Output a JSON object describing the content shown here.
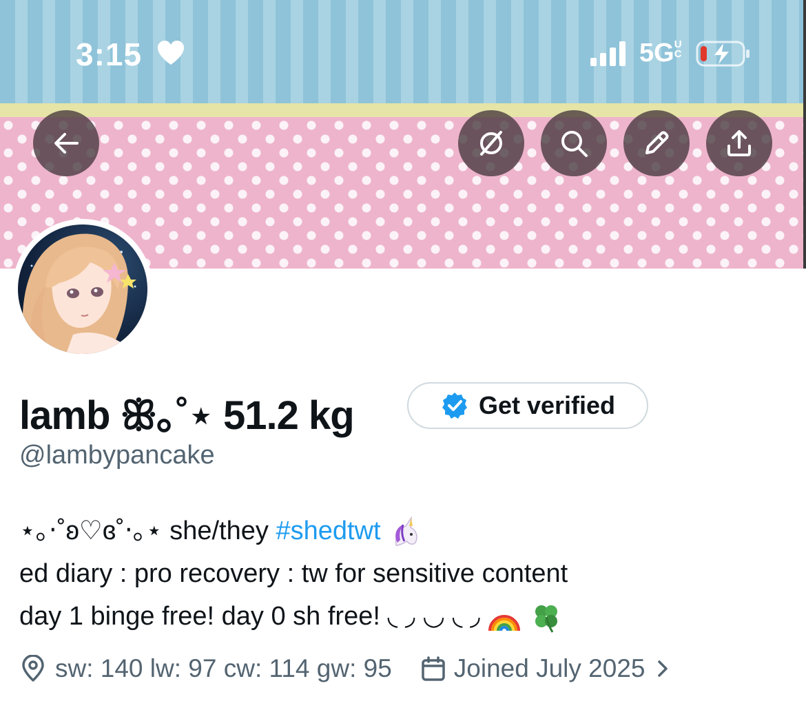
{
  "status_bar": {
    "time": "3:15",
    "network": "5G",
    "network_suffix": "UC"
  },
  "header_buttons": {
    "back": "back-arrow-icon",
    "grok": "grok-icon",
    "search": "search-icon",
    "edit": "pencil-icon",
    "share": "share-icon"
  },
  "profile": {
    "display_name": "lamb ꕥ｡˚⋆ 51.2 kg",
    "verify_label": "Get verified",
    "handle": "@lambypancake",
    "bio": {
      "line1_prefix": "⋆｡‧˚ʚ♡ɞ˚‧｡⋆ she/they ",
      "line1_tag": "#shedtwt",
      "line2": "ed diary : pro recovery : tw for sensitive content",
      "line3": "day 1 binge free! day 0 sh free! ◟ ◞ ◡ ◟ ◞ "
    },
    "location": "sw: 140 lw: 97 cw: 114 gw: 95",
    "joined": "Joined July 2025"
  },
  "colors": {
    "link": "#1d9bf0",
    "secondary_text": "#536471",
    "verified_badge": "#1d9bf0",
    "banner_stripe": "#8fc3d9",
    "banner_pink": "#eeb4cc"
  }
}
